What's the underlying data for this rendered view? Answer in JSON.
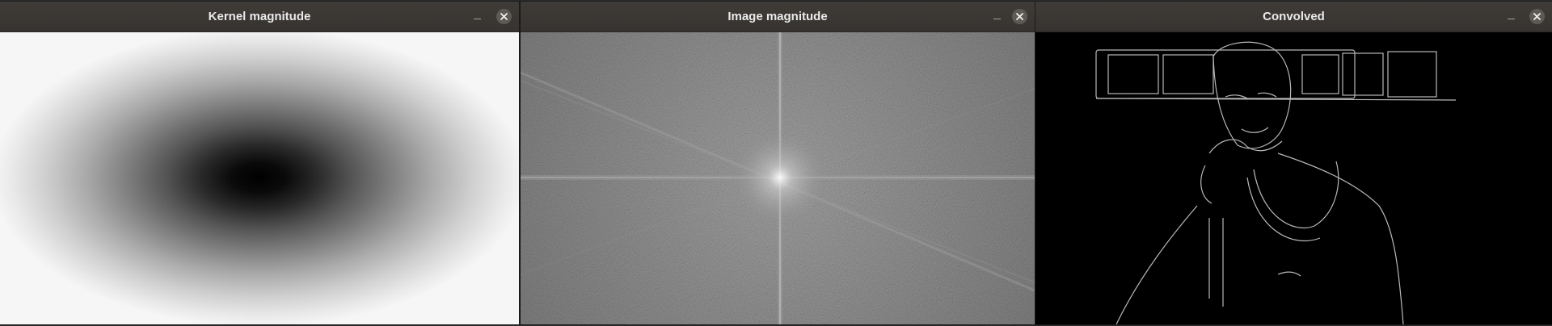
{
  "windows": [
    {
      "title": "Kernel magnitude"
    },
    {
      "title": "Image magnitude"
    },
    {
      "title": "Convolved"
    }
  ],
  "icons": {
    "minimize": "minimize-icon",
    "close": "close-icon"
  },
  "colors": {
    "titlebar": "#3d3a36",
    "title_text": "#ebebeb",
    "close_button": "#5d5a56"
  }
}
